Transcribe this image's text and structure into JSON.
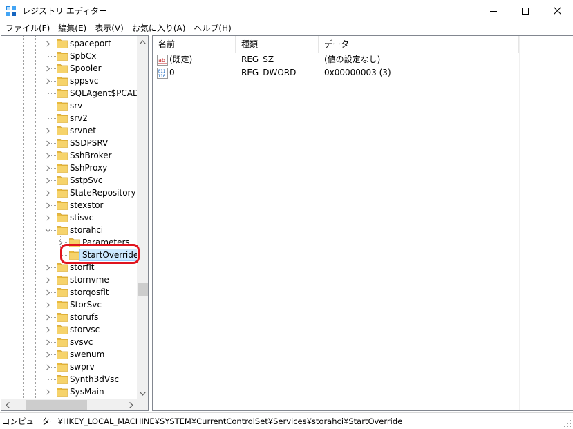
{
  "window": {
    "title": "レジストリ エディター"
  },
  "menu": [
    "ファイル(F)",
    "編集(E)",
    "表示(V)",
    "お気に入り(A)",
    "ヘルプ(H)"
  ],
  "tree": {
    "items": [
      {
        "label": "spaceport",
        "expandable": true
      },
      {
        "label": "SpbCx",
        "expandable": false
      },
      {
        "label": "Spooler",
        "expandable": true
      },
      {
        "label": "sppsvc",
        "expandable": true
      },
      {
        "label": "SQLAgent$PCADB",
        "expandable": false
      },
      {
        "label": "srv",
        "expandable": false
      },
      {
        "label": "srv2",
        "expandable": false
      },
      {
        "label": "srvnet",
        "expandable": true
      },
      {
        "label": "SSDPSRV",
        "expandable": true
      },
      {
        "label": "SshBroker",
        "expandable": true
      },
      {
        "label": "SshProxy",
        "expandable": true
      },
      {
        "label": "SstpSvc",
        "expandable": true
      },
      {
        "label": "StateRepository",
        "expandable": true
      },
      {
        "label": "stexstor",
        "expandable": true
      },
      {
        "label": "stisvc",
        "expandable": true
      },
      {
        "label": "storahci",
        "expandable": true,
        "expanded": true
      },
      {
        "label": "Parameters",
        "expandable": true,
        "child": true
      },
      {
        "label": "StartOverride",
        "expandable": false,
        "child": true,
        "selected": true
      },
      {
        "label": "storflt",
        "expandable": true
      },
      {
        "label": "stornvme",
        "expandable": true
      },
      {
        "label": "storqosflt",
        "expandable": true
      },
      {
        "label": "StorSvc",
        "expandable": true
      },
      {
        "label": "storufs",
        "expandable": true
      },
      {
        "label": "storvsc",
        "expandable": true
      },
      {
        "label": "svsvc",
        "expandable": true
      },
      {
        "label": "swenum",
        "expandable": true
      },
      {
        "label": "swprv",
        "expandable": true
      },
      {
        "label": "Synth3dVsc",
        "expandable": false
      },
      {
        "label": "SysMain",
        "expandable": true
      }
    ]
  },
  "list": {
    "columns": [
      "名前",
      "種類",
      "データ"
    ],
    "rows": [
      {
        "icon": "string-value-icon",
        "name": "(既定)",
        "type": "REG_SZ",
        "data": "(値の設定なし)"
      },
      {
        "icon": "binary-value-icon",
        "name": "0",
        "type": "REG_DWORD",
        "data": "0x00000003 (3)"
      }
    ]
  },
  "status": {
    "path": "コンピューター¥HKEY_LOCAL_MACHINE¥SYSTEM¥CurrentControlSet¥Services¥storahci¥StartOverride"
  },
  "colors": {
    "selection_bg": "#cce8ff",
    "highlight_ring": "#e0141e",
    "folder_yellow": "#f6d36b"
  }
}
